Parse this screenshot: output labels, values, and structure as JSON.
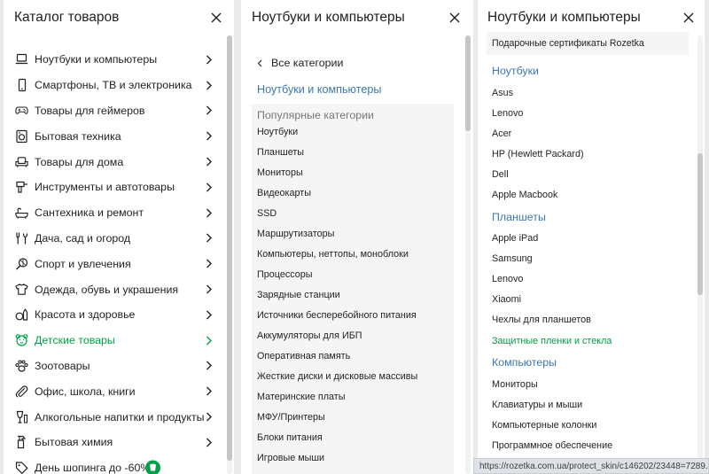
{
  "colors": {
    "accent_green": "#00a046",
    "link_blue": "#3e77aa",
    "text": "#221f1f",
    "muted": "#797878"
  },
  "panel1": {
    "title": "Каталог товаров",
    "items": [
      {
        "label": "Ноутбуки и компьютеры",
        "icon": "laptop-icon"
      },
      {
        "label": "Смартфоны, ТВ и электроника",
        "icon": "smartphone-icon"
      },
      {
        "label": "Товары для геймеров",
        "icon": "gamepad-icon"
      },
      {
        "label": "Бытовая техника",
        "icon": "washing-machine-icon"
      },
      {
        "label": "Товары для дома",
        "icon": "armchair-icon"
      },
      {
        "label": "Инструменты и автотовары",
        "icon": "drill-icon"
      },
      {
        "label": "Сантехника и ремонт",
        "icon": "bathtub-icon"
      },
      {
        "label": "Дача, сад и огород",
        "icon": "garden-tools-icon"
      },
      {
        "label": "Спорт и увлечения",
        "icon": "sport-icon"
      },
      {
        "label": "Одежда, обувь и украшения",
        "icon": "shirt-icon"
      },
      {
        "label": "Красота и здоровье",
        "icon": "cosmetics-icon"
      },
      {
        "label": "Детские товары",
        "icon": "teddy-bear-icon"
      },
      {
        "label": "Зоотовары",
        "icon": "paw-icon"
      },
      {
        "label": "Офис, школа, книги",
        "icon": "paperclip-icon"
      },
      {
        "label": "Алкогольные напитки и продукты",
        "icon": "wine-glass-icon"
      },
      {
        "label": "Бытовая химия",
        "icon": "spray-bottle-icon"
      },
      {
        "label": "День шопинга до -60%",
        "icon": "tag-icon"
      }
    ]
  },
  "panel2": {
    "title": "Ноутбуки и компьютеры",
    "back_label": "Все категории",
    "section_link": "Ноутбуки и компьютеры",
    "popular_title": "Популярные категории",
    "popular_items": [
      "Ноутбуки",
      "Планшеты",
      "Мониторы",
      "Видеокарты",
      "SSD",
      "Маршрутизаторы",
      "Компьютеры, неттопы, моноблоки",
      "Процессоры",
      "Зарядные станции",
      "Источники бесперебойного питания",
      "Аккумуляторы для ИБП",
      "Оперативная память",
      "Жесткие диски и дисковые массивы",
      "Материнские платы",
      "МФУ/Принтеры",
      "Блоки питания",
      "Игровые мыши"
    ]
  },
  "panel3": {
    "title": "Ноутбуки и компьютеры",
    "gift_label": "Подарочные сертификаты Rozetka",
    "groups": [
      {
        "title": "Ноутбуки",
        "items": [
          "Asus",
          "Lenovo",
          "Acer",
          "HP (Hewlett Packard)",
          "Dell",
          "Apple Macbook"
        ]
      },
      {
        "title": "Планшеты",
        "items": [
          "Apple iPad",
          "Samsung",
          "Lenovo",
          "Xiaomi",
          "Чехлы для планшетов",
          "Защитные пленки и стекла"
        ]
      },
      {
        "title": "Компьютеры",
        "items": [
          "Мониторы",
          "Клавиатуры и мыши",
          "Компьютерные колонки",
          "Программное обеспечение"
        ]
      }
    ]
  },
  "status_url": "https://rozetka.com.ua/protect_skin/c146202/23448=7289..."
}
